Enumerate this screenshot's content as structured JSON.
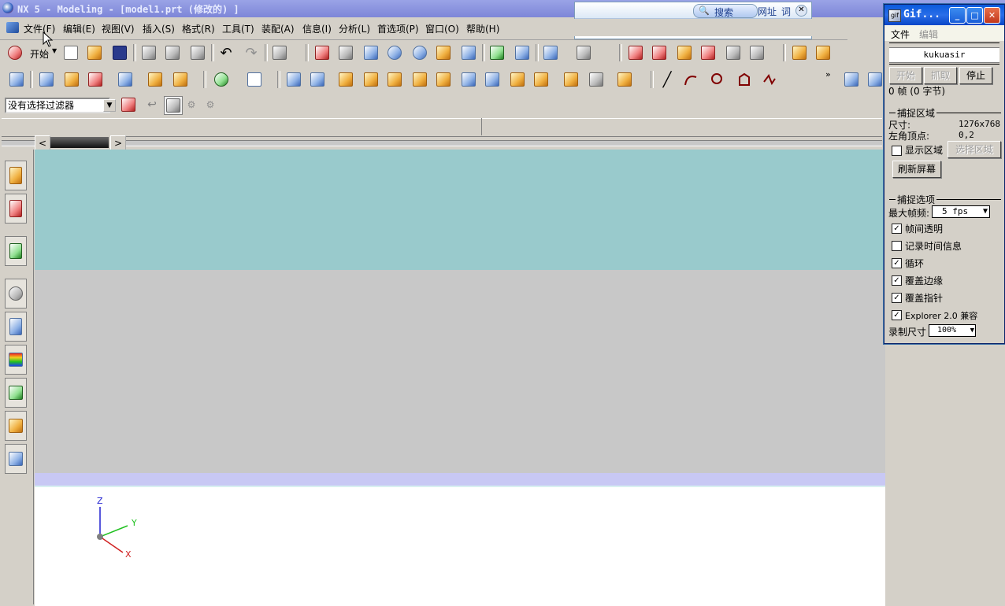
{
  "app": {
    "title": "NX 5 - Modeling - [model1.prt  (修改的) ]"
  },
  "menu": {
    "items": [
      "文件(F)",
      "编辑(E)",
      "视图(V)",
      "插入(S)",
      "格式(R)",
      "工具(T)",
      "装配(A)",
      "信息(I)",
      "分析(L)",
      "首选项(P)",
      "窗口(O)",
      "帮助(H)"
    ]
  },
  "toolbar": {
    "start_label": "开始",
    "filter_value": "没有选择过滤器"
  },
  "search": {
    "search_label": "搜索",
    "url_label": "网址",
    "word_label": "词"
  },
  "axes": {
    "z": "Z",
    "y": "Y",
    "x": "X"
  },
  "gif": {
    "title": "Gif...",
    "menu_file": "文件",
    "menu_edit": "编辑",
    "user": "kukuasir",
    "btn_start": "开始",
    "btn_grab": "抓取",
    "btn_stop": "停止",
    "frames": "0 帧 (0 字节)",
    "capture_area": "捕捉区域",
    "size_label": "尺寸:",
    "size_value": "1276x768",
    "corner_label": "左角顶点:",
    "corner_value": "0,2",
    "show_area": "显示区域",
    "select_area": "选择区域",
    "refresh": "刷新屏幕",
    "capture_options": "捕捉选项",
    "max_fps_label": "最大帧频:",
    "max_fps_value": "5 fps",
    "options": [
      {
        "label": "帧间透明",
        "checked": true
      },
      {
        "label": "记录时间信息",
        "checked": false
      },
      {
        "label": "循环",
        "checked": true
      },
      {
        "label": "覆盖边缘",
        "checked": true
      },
      {
        "label": "覆盖指针",
        "checked": true
      },
      {
        "label": "Explorer 2.0 兼容",
        "checked": true
      }
    ],
    "record_size_label": "录制尺寸",
    "record_size_value": "100%"
  },
  "colors": {
    "graphics_top": "#99cacc",
    "graphics_mid": "#c8c8c8",
    "graphics_band": "#c8c8f4",
    "graphics_bottom": "#ffffff",
    "axis_z": "#2020d0",
    "axis_y": "#20c020",
    "axis_x": "#d02020"
  }
}
